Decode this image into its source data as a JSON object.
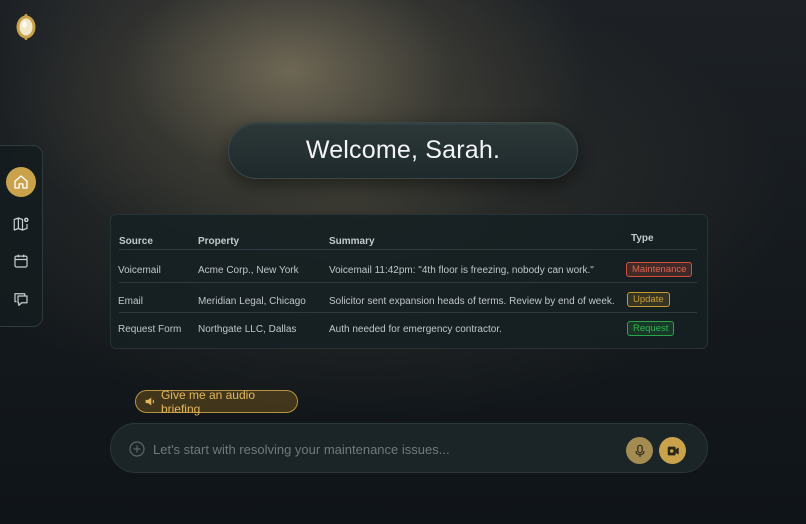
{
  "app": {
    "logo_icon": "mirror-logo-icon",
    "accent_color": "#c9a24b"
  },
  "sidebar": {
    "items": [
      {
        "icon": "home-icon",
        "active": true
      },
      {
        "icon": "map-pin-icon",
        "active": false
      },
      {
        "icon": "calendar-icon",
        "active": false
      },
      {
        "icon": "chat-icon",
        "active": false
      }
    ]
  },
  "welcome": {
    "text": "Welcome, Sarah."
  },
  "table": {
    "headers": {
      "source": "Source",
      "property": "Property",
      "summary": "Summary",
      "type": "Type"
    },
    "rows": [
      {
        "source": "Voicemail",
        "property": "Acme Corp., New York",
        "summary": "Voicemail 11:42pm: \"4th floor is freezing, nobody can work.\"",
        "type": "Maintenance"
      },
      {
        "source": "Email",
        "property": "Meridian Legal, Chicago",
        "summary": "Solicitor sent expansion heads of terms. Review by end of week.",
        "type": "Update"
      },
      {
        "source": "Request Form",
        "property": "Northgate LLC, Dallas",
        "summary": "Auth needed for emergency contractor.",
        "type": "Request"
      }
    ],
    "type_colors": {
      "Maintenance": "#d4503c",
      "Update": "#c59a2c",
      "Request": "#2aa448"
    }
  },
  "audio_briefing": {
    "label": "Give me an audio briefing",
    "icon": "speaker-icon"
  },
  "chat": {
    "placeholder": "Let's start with resolving your maintenance issues...",
    "value": "",
    "plus_icon": "plus-circle-icon",
    "mic_icon": "microphone-icon",
    "send_icon": "send-icon"
  }
}
